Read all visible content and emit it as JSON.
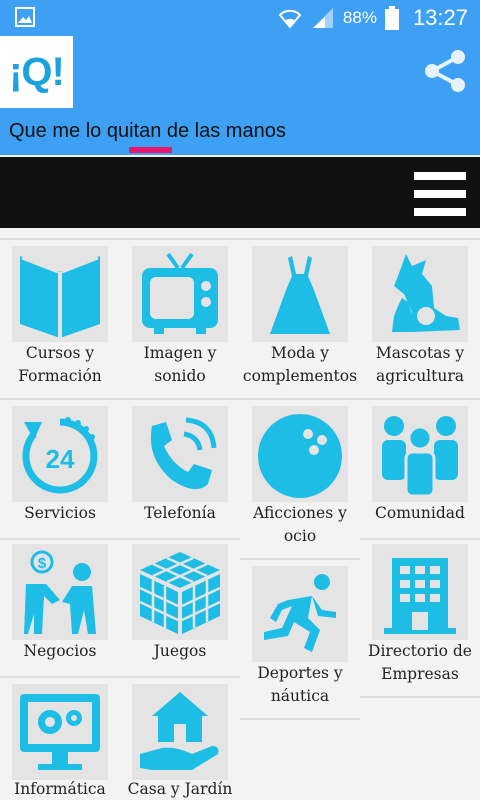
{
  "status_bar": {
    "battery": "88%",
    "time": "13:27",
    "icons": [
      "gallery-icon",
      "wifi-icon",
      "signal-icon",
      "battery-icon"
    ]
  },
  "app_bar": {
    "logo_text": "¡Q!",
    "tagline": "Que me lo quitan de las manos",
    "share_icon": "share-icon",
    "accent_color": "#3ea0f2",
    "indicator_color": "#e8176b"
  },
  "menu_bar": {
    "icon": "hamburger-menu-icon"
  },
  "categories": [
    {
      "label": "Cursos y Formación",
      "icon": "book-icon"
    },
    {
      "label": "Imagen y sonido",
      "icon": "tv-icon"
    },
    {
      "label": "Moda y complementos",
      "icon": "dress-icon"
    },
    {
      "label": "Mascotas y agricultura",
      "icon": "pets-icon"
    },
    {
      "label": "Servicios",
      "icon": "24h-service-icon"
    },
    {
      "label": "Telefonía",
      "icon": "phone-icon"
    },
    {
      "label": "Aficciones y ocio",
      "icon": "bowling-ball-icon"
    },
    {
      "label": "Comunidad",
      "icon": "community-icon"
    },
    {
      "label": "Negocios",
      "icon": "business-handshake-icon"
    },
    {
      "label": "Juegos",
      "icon": "rubiks-cube-icon"
    },
    {
      "label": "Deportes y náutica",
      "icon": "runner-icon"
    },
    {
      "label": "Directorio de Empresas",
      "icon": "building-icon"
    },
    {
      "label": "Informática",
      "icon": "computer-settings-icon"
    },
    {
      "label": "Casa y Jardín",
      "icon": "house-hand-icon"
    }
  ]
}
